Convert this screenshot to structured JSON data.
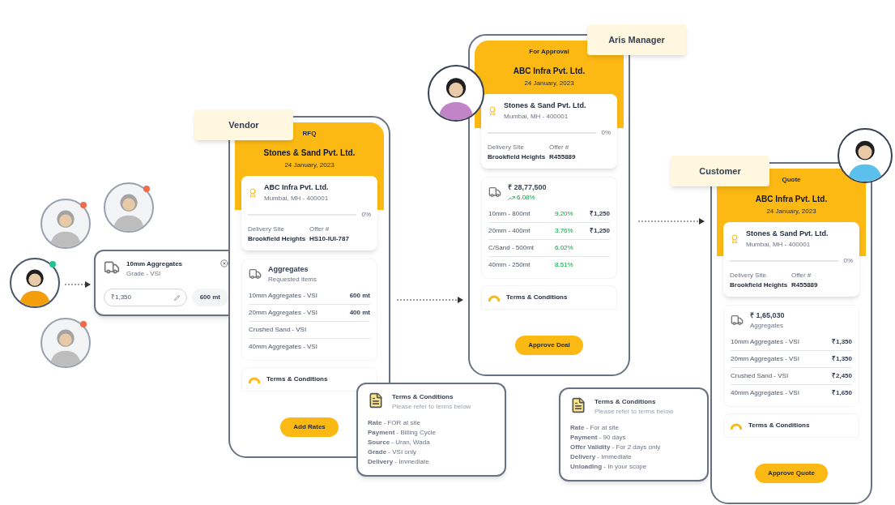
{
  "users": [
    {
      "color": "#ef6b4a",
      "selected": false
    },
    {
      "color": "#ef6b4a",
      "selected": false
    },
    {
      "color": "#22c38e",
      "selected": true
    },
    {
      "color": "#ef6b4a",
      "selected": false
    }
  ],
  "item_card": {
    "title": "10mm Aggregates",
    "subtitle": "Grade - VSI",
    "price": "₹1,350",
    "quantity": "600 mt"
  },
  "phones": [
    {
      "role_label": "Vendor",
      "status": "RFQ",
      "company": "Stones & Sand Pvt. Ltd.",
      "date": "24 January, 2023",
      "party": {
        "name": "ABC Infra Pvt. Ltd.",
        "address": "Mumbai, MH - 400001"
      },
      "progress": {
        "reading": "0%"
      },
      "fields": [
        {
          "label": "Delivery Site",
          "value": "Brookfield Heights"
        },
        {
          "label": "Offer #",
          "value": "HS10-IUI-787"
        }
      ],
      "summary": {
        "title": "Aggregates",
        "subtitle": "Requested items"
      },
      "rows": [
        {
          "name": "10mm Aggregates - VSI",
          "value": "600 mt"
        },
        {
          "name": "20mm Aggregates - VSI",
          "value": "400 mt"
        },
        {
          "name": "Crushed Sand - VSI"
        },
        {
          "name": "40mm Aggregates - VSI"
        }
      ],
      "terms_title": "Terms & Conditions",
      "button": "Add Rates"
    },
    {
      "role_label": "Aris Manager",
      "status": "For Approval",
      "company": "ABC Infra Pvt. Ltd.",
      "date": "24 January, 2023",
      "party": {
        "name": "Stones & Sand Pvt. Ltd.",
        "address": "Mumbai, MH - 400001"
      },
      "progress": {
        "reading": "0%"
      },
      "fields": [
        {
          "label": "Delivery Site",
          "value": "Brookfield Heights"
        },
        {
          "label": "Offer #",
          "value": "R455889"
        }
      ],
      "summary": {
        "title": "₹ 28,77,500",
        "trend": "6.08%"
      },
      "rows": [
        {
          "name": "10mm - 800mt",
          "change": "9.20%",
          "value": "₹1,250"
        },
        {
          "name": "20mm - 400mt",
          "change": "3.76%",
          "value": "₹1,250"
        },
        {
          "name": "C/Sand - 500mt",
          "change": "6.02%"
        },
        {
          "name": "40mm - 250mt",
          "change": "8.51%"
        }
      ],
      "terms_title": "Terms & Conditions",
      "button": "Approve Deal"
    },
    {
      "role_label": "Customer",
      "status": "Quote",
      "company": "ABC Infra Pvt. Ltd.",
      "date": "24 January, 2023",
      "party": {
        "name": "Stones & Sand Pvt. Ltd.",
        "address": "Mumbai, MH - 400001"
      },
      "progress": {
        "reading": "0%"
      },
      "fields": [
        {
          "label": "Delivery Site",
          "value": "Brookfield Heights"
        },
        {
          "label": "Offer #",
          "value": "R455889"
        }
      ],
      "summary": {
        "title": "₹ 1,65,030",
        "subtitle": "Aggregates"
      },
      "rows": [
        {
          "name": "10mm Aggregates - VSI",
          "value": "₹1,350"
        },
        {
          "name": "20mm Aggregates - VSI",
          "value": "₹1,350"
        },
        {
          "name": "Crushed Sand - VSI",
          "value": "₹2,450"
        },
        {
          "name": "40mm Aggregates - VSI",
          "value": "₹1,650"
        }
      ],
      "terms_title": "Terms & Conditions",
      "button": "Approve Quote"
    }
  ],
  "terms_cards": [
    {
      "title": "Terms & Conditions",
      "subtitle": "Please refer to terms below",
      "terms": [
        "**Rate** - FOR at site",
        "**Payment** - Billing Cycle",
        "**Source** - Uran, Wada",
        "**Grade** - VSI only",
        "**Delivery** - Immediate"
      ]
    },
    {
      "title": "Terms & Conditions",
      "subtitle": "Please refer to terms below",
      "terms": [
        "**Rate** - For at site",
        "**Payment** - 90 days",
        "**Offer Validity** - For 2 days only",
        "**Delivery** - Immediate",
        "**Unloading** - In your scope"
      ]
    }
  ]
}
